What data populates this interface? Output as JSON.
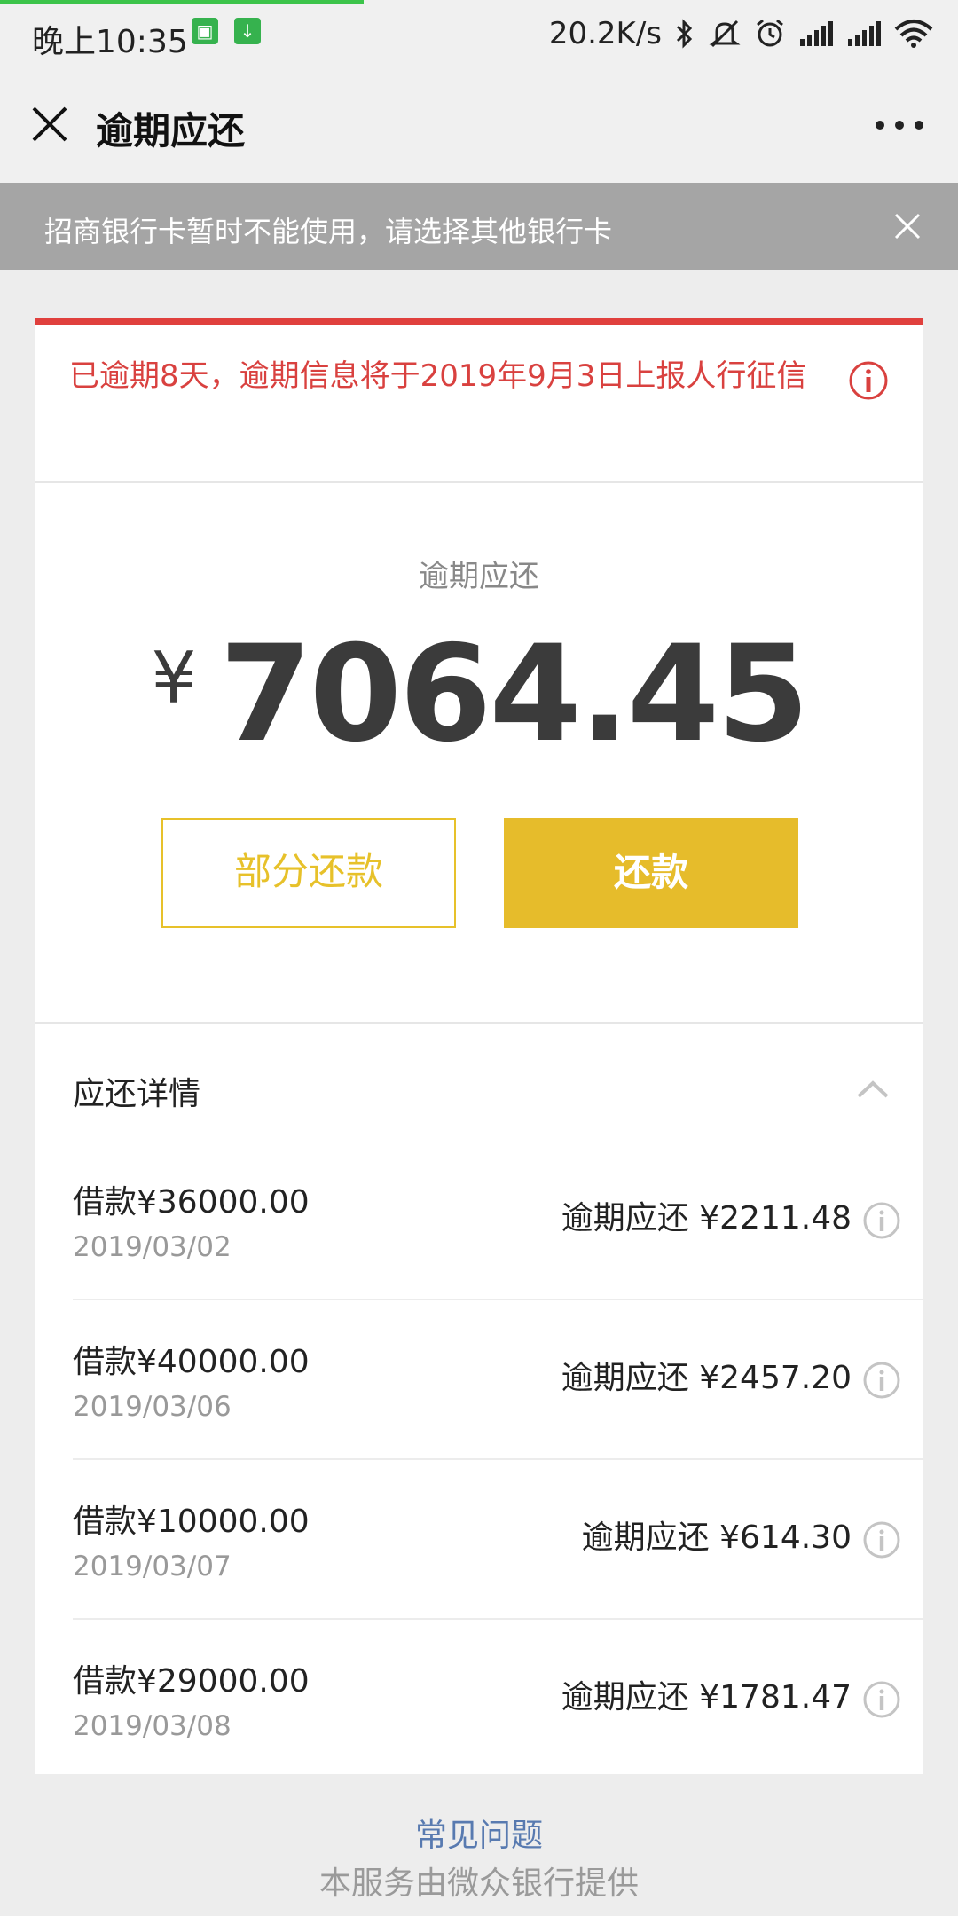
{
  "status": {
    "time": "晚上10:35",
    "speed": "20.2K/s",
    "icons": [
      "app-badge-icon",
      "download-icon",
      "bluetooth-icon",
      "mute-icon",
      "alarm-icon",
      "signal-icon",
      "signal-icon",
      "wifi-icon"
    ]
  },
  "header": {
    "title": "逾期应还"
  },
  "notice": {
    "text": "招商银行卡暂时不能使用，请选择其他银行卡"
  },
  "warning": {
    "text": "已逾期8天，逾期信息将于2019年9月3日上报人行征信"
  },
  "summary": {
    "label": "逾期应还",
    "currency": "¥",
    "amount": "7064.45",
    "partial_button": "部分还款",
    "repay_button": "还款"
  },
  "details": {
    "title": "应还详情",
    "rows": [
      {
        "loan": "借款¥36000.00",
        "date": "2019/03/02",
        "due": "逾期应还 ¥2211.48"
      },
      {
        "loan": "借款¥40000.00",
        "date": "2019/03/06",
        "due": "逾期应还 ¥2457.20"
      },
      {
        "loan": "借款¥10000.00",
        "date": "2019/03/07",
        "due": "逾期应还 ¥614.30"
      },
      {
        "loan": "借款¥29000.00",
        "date": "2019/03/08",
        "due": "逾期应还 ¥1781.47"
      }
    ]
  },
  "footer": {
    "faq": "常见问题",
    "provider": "本服务由微众银行提供"
  },
  "colors": {
    "accent_red": "#e0403d",
    "accent_yellow": "#e6bc2b",
    "link_blue": "#587ab0"
  }
}
